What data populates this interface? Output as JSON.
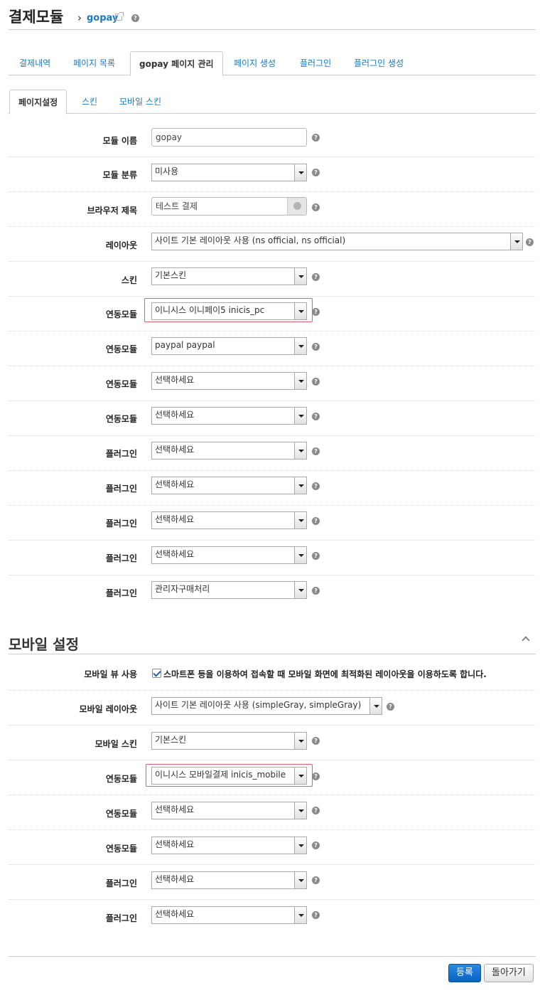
{
  "header": {
    "title": "결제모듈",
    "breadcrumb": "gopay"
  },
  "main_tabs": [
    "결제내역",
    "페이지 목록",
    "gopay 페이지 관리",
    "페이지 생성",
    "플러그인",
    "플러그인 생성"
  ],
  "sub_tabs": [
    "페이지설정",
    "스킨",
    "모바일 스킨"
  ],
  "form": {
    "module_name": {
      "label": "모듈 이름",
      "value": "gopay"
    },
    "module_category": {
      "label": "모듈 분류",
      "value": "미사용"
    },
    "browser_title": {
      "label": "브라우저 제목",
      "value": "테스트 결제"
    },
    "layout": {
      "label": "레이아웃",
      "value": "사이트 기본 레이아웃 사용 (ns official, ns official)"
    },
    "skin": {
      "label": "스킨",
      "value": "기본스킨"
    },
    "linked": [
      {
        "label": "연동모듈",
        "value": "이니시스 이니페이5 inicis_pc"
      },
      {
        "label": "연동모듈",
        "value": "paypal paypal"
      },
      {
        "label": "연동모듈",
        "value": "선택하세요"
      },
      {
        "label": "연동모듈",
        "value": "선택하세요"
      }
    ],
    "plugins": [
      {
        "label": "플러그인",
        "value": "선택하세요"
      },
      {
        "label": "플러그인",
        "value": "선택하세요"
      },
      {
        "label": "플러그인",
        "value": "선택하세요"
      },
      {
        "label": "플러그인",
        "value": "선택하세요"
      },
      {
        "label": "플러그인",
        "value": "관리자구매처리"
      }
    ]
  },
  "mobile": {
    "section_title": "모바일 설정",
    "mobile_view": {
      "label": "모바일 뷰 사용",
      "checkbox_text": "스마트폰 등을 이용하여 접속할 때 모바일 화면에 최적화된 레이아웃을 이용하도록 합니다.",
      "checked": true
    },
    "layout": {
      "label": "모바일 레이아웃",
      "value": "사이트 기본 레이아웃 사용 (simpleGray, simpleGray)"
    },
    "skin": {
      "label": "모바일 스킨",
      "value": "기본스킨"
    },
    "linked": [
      {
        "label": "연동모듈",
        "value": "이니시스 모바일결제 inicis_mobile"
      },
      {
        "label": "연동모듈",
        "value": "선택하세요"
      },
      {
        "label": "연동모듈",
        "value": "선택하세요"
      }
    ],
    "plugins": [
      {
        "label": "플러그인",
        "value": "선택하세요"
      },
      {
        "label": "플러그인",
        "value": "선택하세요"
      }
    ]
  },
  "buttons": {
    "submit": "등록",
    "back": "돌아가기"
  },
  "colors": {
    "link": "#1a7abf",
    "highlight": "#e06070",
    "primary": "#0a62c0"
  }
}
